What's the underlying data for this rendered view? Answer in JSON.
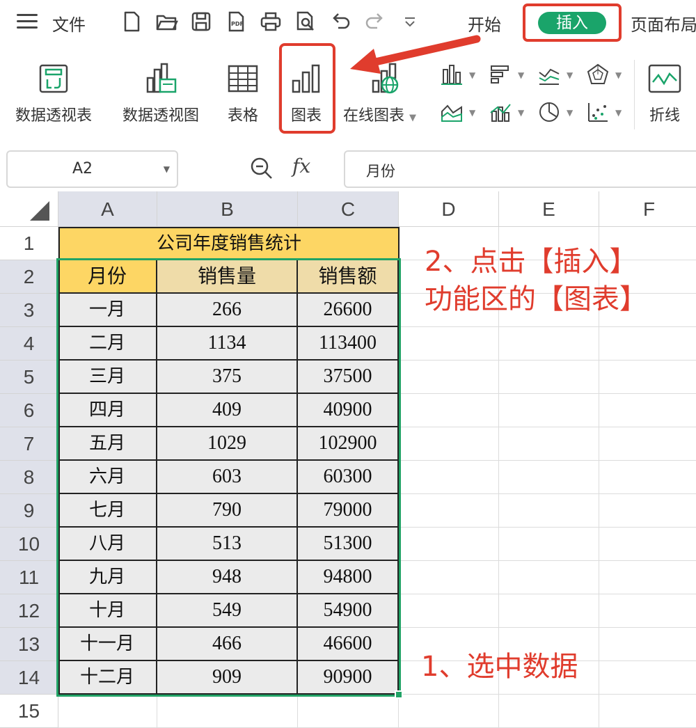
{
  "topbar": {
    "file_label": "文件",
    "tabs": {
      "start": "开始",
      "insert": "插入",
      "layout": "页面布局"
    }
  },
  "ribbon": {
    "pivot_table": "数据透视表",
    "pivot_chart": "数据透视图",
    "table": "表格",
    "chart": "图表",
    "online_chart": "在线图表",
    "line": "折线"
  },
  "formula_bar": {
    "cell_ref": "A2",
    "fx": "fx",
    "content": "月份"
  },
  "sheet": {
    "columns": [
      "A",
      "B",
      "C",
      "D",
      "E",
      "F"
    ],
    "rows": [
      "1",
      "2",
      "3",
      "4",
      "5",
      "6",
      "7",
      "8",
      "9",
      "10",
      "11",
      "12",
      "13",
      "14",
      "15"
    ],
    "title": "公司年度销售统计",
    "headers": [
      "月份",
      "销售量",
      "销售额"
    ],
    "data": [
      [
        "一月",
        "266",
        "26600"
      ],
      [
        "二月",
        "1134",
        "113400"
      ],
      [
        "三月",
        "375",
        "37500"
      ],
      [
        "四月",
        "409",
        "40900"
      ],
      [
        "五月",
        "1029",
        "102900"
      ],
      [
        "六月",
        "603",
        "60300"
      ],
      [
        "七月",
        "790",
        "79000"
      ],
      [
        "八月",
        "513",
        "51300"
      ],
      [
        "九月",
        "948",
        "94800"
      ],
      [
        "十月",
        "549",
        "54900"
      ],
      [
        "十一月",
        "466",
        "46600"
      ],
      [
        "十二月",
        "909",
        "90900"
      ]
    ]
  },
  "annotations": {
    "step2_line1": "2、点击【插入】",
    "step2_line2": "功能区的【图表】",
    "step1": "1、选中数据"
  },
  "colors": {
    "accent_green": "#1aa46a",
    "highlight_red": "#e03c2d",
    "title_fill": "#fdd664",
    "header_fill": "#efdca9",
    "data_fill": "#ebebeb"
  }
}
